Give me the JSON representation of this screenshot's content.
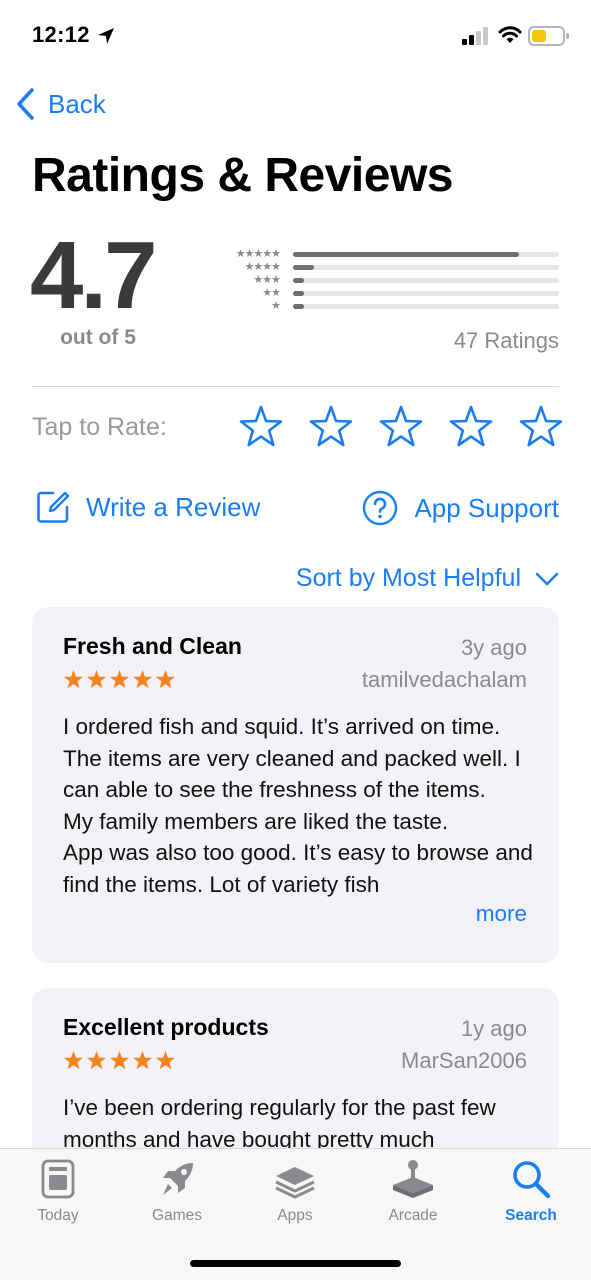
{
  "status_bar": {
    "time": "12:12",
    "icons": [
      "location-arrow-icon",
      "cellular-signal-icon",
      "wifi-icon",
      "battery-low-icon"
    ]
  },
  "nav": {
    "back_label": "Back",
    "back_icon": "chevron-left-icon"
  },
  "title": "Ratings & Reviews",
  "summary": {
    "average": "4.7",
    "out_of": "out of 5",
    "ratings_count": "47 Ratings",
    "histogram": [
      {
        "stars": "★★★★★",
        "fraction": 0.85
      },
      {
        "stars": "★★★★",
        "fraction": 0.08
      },
      {
        "stars": "★★★",
        "fraction": 0.02
      },
      {
        "stars": "★★",
        "fraction": 0.0
      },
      {
        "stars": "★",
        "fraction": 0.04
      }
    ]
  },
  "tap_to_rate": {
    "label": "Tap to Rate:",
    "star_count": 5,
    "icon": "star-outline-icon"
  },
  "actions": {
    "write_review": "Write a Review",
    "write_review_icon": "compose-icon",
    "app_support": "App Support",
    "app_support_icon": "question-circle-icon"
  },
  "sort": {
    "label": "Sort by Most Helpful",
    "icon": "chevron-down-icon"
  },
  "reviews": [
    {
      "title": "Fresh and Clean",
      "date": "3y ago",
      "author": "tamilvedachalam",
      "rating": 5,
      "body": "I ordered fish and squid. It’s arrived on time. The items are very cleaned and packed well. I can able to see the freshness of the items.\nMy family members are liked the taste.\nApp was also too good. It’s easy to browse and find the items. Lot of variety fish",
      "more_label": "more"
    },
    {
      "title": "Excellent products",
      "date": "1y ago",
      "author": "MarSan2006",
      "rating": 5,
      "body": "I’ve been ordering regularly for the past few months and have bought pretty much"
    }
  ],
  "colors": {
    "accent": "#1a7ef2",
    "star_orange": "#f6821f",
    "card_bg": "#f2f2f7",
    "secondary_text": "#8a8a8e"
  },
  "tab_bar": {
    "tabs": [
      {
        "label": "Today",
        "icon": "today-icon",
        "active": false
      },
      {
        "label": "Games",
        "icon": "rocket-icon",
        "active": false
      },
      {
        "label": "Apps",
        "icon": "apps-stack-icon",
        "active": false
      },
      {
        "label": "Arcade",
        "icon": "joystick-icon",
        "active": false
      },
      {
        "label": "Search",
        "icon": "search-icon",
        "active": true
      }
    ]
  }
}
